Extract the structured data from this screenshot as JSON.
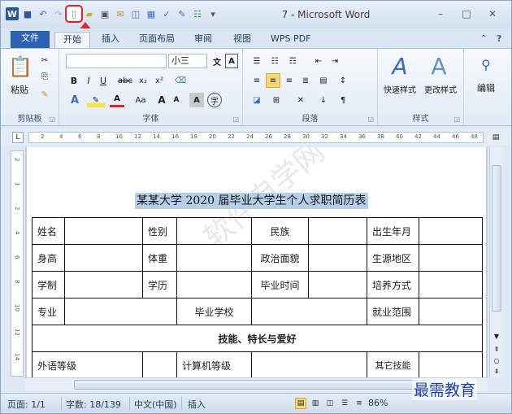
{
  "titlebar": {
    "title": "7 - Microsoft Word",
    "word_logo": "W",
    "minimize": "–",
    "restore": "□",
    "close": "✕"
  },
  "tabs": [
    "文件",
    "开始",
    "插入",
    "页面布局",
    "审阅",
    "视图",
    "WPS PDF"
  ],
  "ribbon": {
    "paste_label": "粘贴",
    "font_size": "小三",
    "font_name": "",
    "bold": "B",
    "italic": "I",
    "underline": "U",
    "strike": "abc",
    "sub": "x₂",
    "sup": "x²",
    "grow": "A",
    "shrink": "A",
    "aa": "Aa",
    "style1_label": "快速样式",
    "style2_label": "更改样式",
    "edit_label": "编辑",
    "groups": [
      "剪贴板",
      "字体",
      "段落",
      "样式"
    ]
  },
  "ruler": {
    "ticks": [
      "2",
      "4",
      "6",
      "8",
      "10",
      "12",
      "14",
      "16",
      "18",
      "20",
      "22",
      "24",
      "26",
      "28",
      "30",
      "32",
      "34",
      "36",
      "38",
      "40",
      "42",
      "44",
      "46",
      "48"
    ],
    "vticks": [
      "2",
      "1",
      "2",
      "4",
      "6",
      "8",
      "10",
      "12",
      "14"
    ]
  },
  "document": {
    "title": "某某大学 2020 届毕业大学生个人求职简历表",
    "watermark": "软件自学网",
    "rows": [
      [
        "姓名",
        "",
        "性别",
        "",
        "民族",
        "",
        "出生年月",
        ""
      ],
      [
        "身高",
        "",
        "体重",
        "",
        "政治面貌",
        "",
        "生源地区",
        ""
      ],
      [
        "学制",
        "",
        "学历",
        "",
        "毕业时间",
        "",
        "培养方式",
        ""
      ]
    ],
    "row4": {
      "c1": "专业",
      "c2": "毕业学校",
      "c3": "就业范围"
    },
    "section": "技能、特长与爱好",
    "row6": {
      "c1": "外语等级",
      "c2": "计算机等级",
      "c3": "其它技能"
    }
  },
  "status": {
    "page": "页面: 1/1",
    "words": "字数: 18/139",
    "lang": "中文(中国)",
    "mode": "插入",
    "zoom": "86%"
  },
  "brand": "最需教育"
}
